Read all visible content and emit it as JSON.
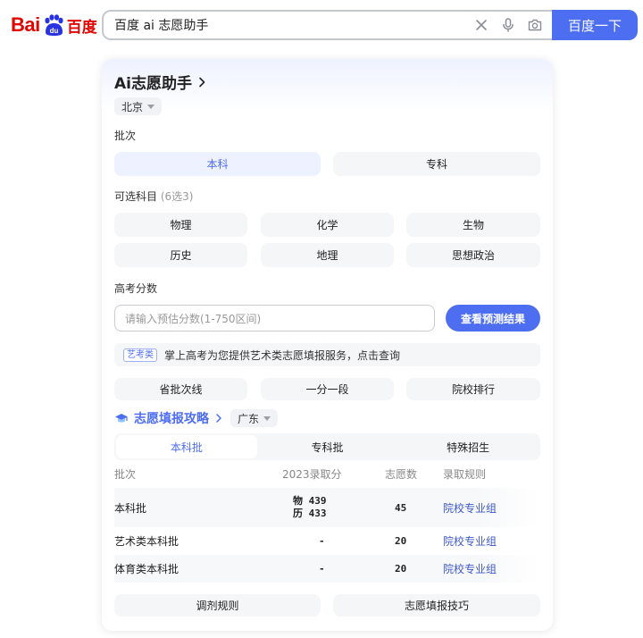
{
  "header": {
    "logo_text": "Bai",
    "logo_mark": "du",
    "logo_cn": "百度",
    "query": "百度 ai 志愿助手",
    "search_button": "百度一下",
    "clear_icon": "close-icon",
    "voice_icon": "microphone-icon",
    "camera_icon": "camera-icon"
  },
  "card": {
    "title": "Ai志愿助手",
    "region": "北京",
    "batch_label": "批次",
    "batches": [
      {
        "label": "本科",
        "active": true
      },
      {
        "label": "专科",
        "active": false
      }
    ],
    "subjects_label": "可选科目",
    "subjects_hint": "(6选3)",
    "subjects": [
      "物理",
      "化学",
      "生物",
      "历史",
      "地理",
      "思想政治"
    ],
    "score_label": "高考分数",
    "score_placeholder": "请输入预估分数(1-750区间)",
    "predict_button": "查看预测结果",
    "art_tag": "艺考类",
    "art_text": "掌上高考为您提供艺术类志愿填报服务，点击查询",
    "quick_links": [
      "省批次线",
      "一分一段",
      "院校排行"
    ],
    "guide": {
      "title": "志愿填报攻略",
      "region": "广东",
      "tabs": [
        {
          "label": "本科批",
          "active": true
        },
        {
          "label": "专科批",
          "active": false
        },
        {
          "label": "特殊招生",
          "active": false
        }
      ],
      "table": {
        "headers": [
          "批次",
          "2023录取分",
          "志愿数",
          "录取规则"
        ],
        "rows": [
          {
            "batch": "本科批",
            "score_line1": "物 439",
            "score_line2": "历 433",
            "count": "45",
            "rule": "院校专业组"
          },
          {
            "batch": "艺术类本科批",
            "score_line1": "-",
            "score_line2": "",
            "count": "20",
            "rule": "院校专业组"
          },
          {
            "batch": "体育类本科批",
            "score_line1": "-",
            "score_line2": "",
            "count": "20",
            "rule": "院校专业组"
          }
        ]
      },
      "footer_buttons": [
        "调剂规则",
        "志愿填报技巧"
      ]
    }
  },
  "colors": {
    "brand_red": "#e10601",
    "accent_blue": "#4e6ef2",
    "link_blue": "#3e58c7"
  }
}
